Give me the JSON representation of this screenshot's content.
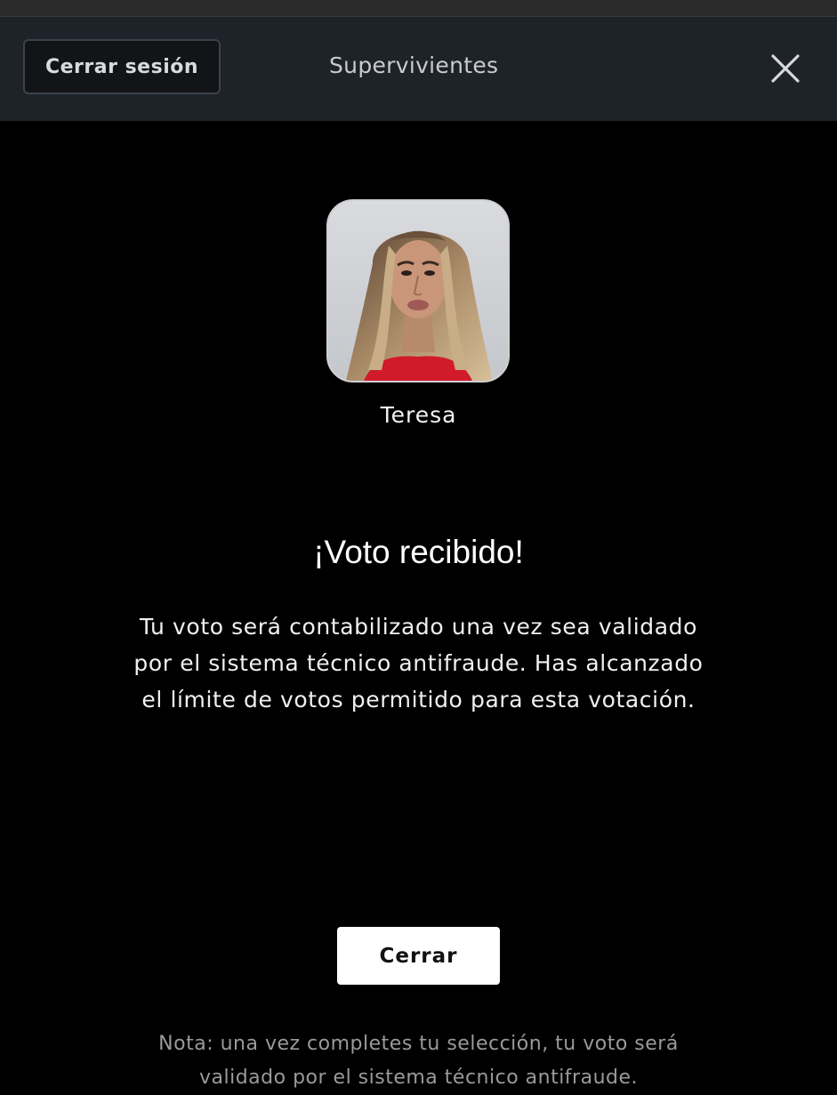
{
  "header": {
    "logout_label": "Cerrar sesión",
    "title": "Supervivientes"
  },
  "contestant": {
    "name": "Teresa"
  },
  "confirmation": {
    "title": "¡Voto recibido!",
    "message": "Tu voto será contabilizado una vez sea validado por el sistema técnico antifraude. Has alcanzado el límite de votos permitido para esta votación.",
    "close_label": "Cerrar",
    "note": "Nota: una vez completes tu selección, tu voto será validado por el sistema técnico antifraude."
  },
  "icons": {
    "close": "close-icon"
  },
  "colors": {
    "background": "#000000",
    "header": "#1e2329",
    "primary_button": "#ffffff"
  }
}
